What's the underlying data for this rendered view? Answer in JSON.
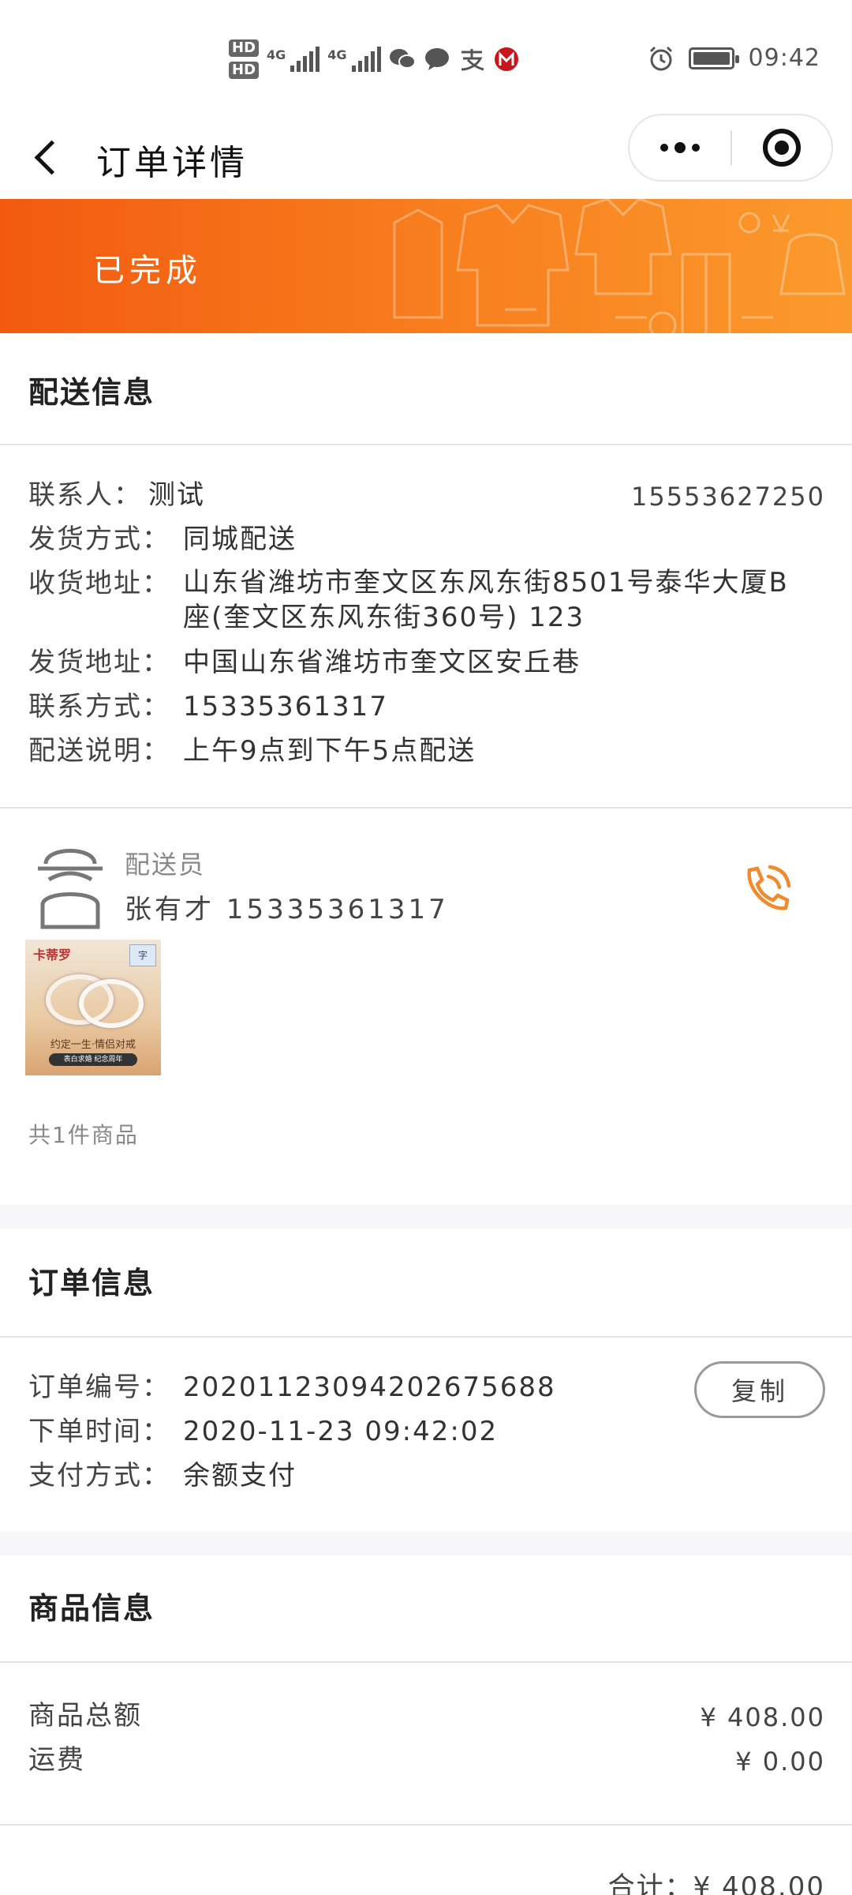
{
  "status_bar": {
    "hd1": "HD",
    "hd2": "HD",
    "net1": "4G",
    "net2": "4G",
    "time": "09:42",
    "icons": [
      "wechat-icon",
      "message-icon",
      "alipay-icon",
      "bank-icon",
      "alarm-icon",
      "battery-icon"
    ]
  },
  "nav": {
    "title": "订单详情"
  },
  "banner": {
    "status": "已完成"
  },
  "delivery": {
    "section_title": "配送信息",
    "contact_label": "联系人：",
    "contact_name": "测试",
    "contact_phone": "15553627250",
    "ship_method_label": "发货方式：",
    "ship_method": "同城配送",
    "recv_addr_label": "收货地址：",
    "recv_addr_line1": "山东省潍坊市奎文区东风东街8501号泰华大厦B",
    "recv_addr_line2": "座(奎文区东风东街360号) 123",
    "send_addr_label": "发货地址：",
    "send_addr": "中国山东省潍坊市奎文区安丘巷",
    "contact_way_label": "联系方式：",
    "contact_way": "15335361317",
    "note_label": "配送说明：",
    "note": "上午9点到下午5点配送"
  },
  "courier": {
    "label": "配送员",
    "name_phone": "张有才 15335361317"
  },
  "product_thumb": {
    "brand": "卡蒂罗",
    "slogan": "约定一生·情侣对戒",
    "tag": "表白求婚 纪念周年",
    "badge": "字"
  },
  "goods_count": "共1件商品",
  "order": {
    "section_title": "订单信息",
    "no_label": "订单编号：",
    "no": "20201123094202675688",
    "time_label": "下单时间：",
    "time": "2020-11-23 09:42:02",
    "pay_label": "支付方式：",
    "pay": "余额支付",
    "copy_label": "复制"
  },
  "goods_info": {
    "section_title": "商品信息",
    "total_label": "商品总额",
    "total_value": "¥ 408.00",
    "freight_label": "运费",
    "freight_value": "¥ 0.00",
    "sum_text": "合计：¥ 408.00"
  },
  "colors": {
    "banner_start": "#f25a10",
    "banner_end": "#fb9a2c",
    "accent": "#f08a2c"
  }
}
